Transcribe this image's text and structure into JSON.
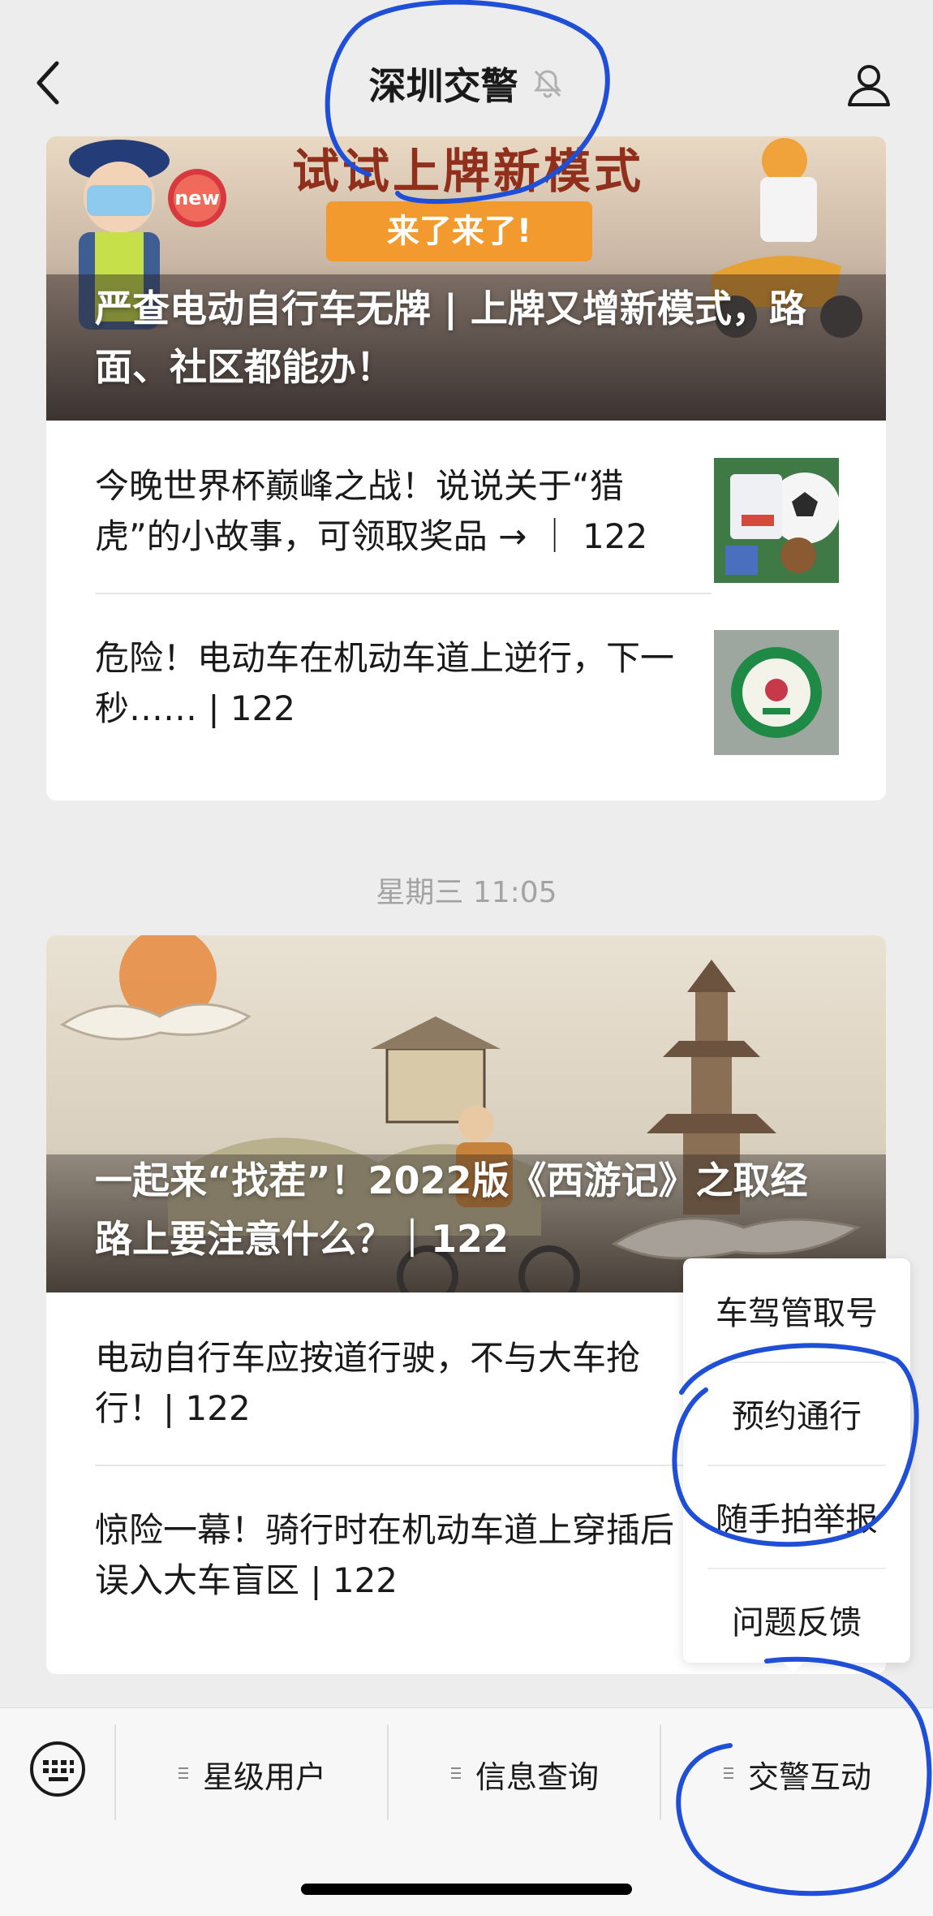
{
  "header": {
    "title": "深圳交警",
    "back_icon": "chevron-left-icon",
    "mute_icon": "bell-muted-icon",
    "profile_icon": "person-icon"
  },
  "feed": {
    "card1": {
      "banner_text": "试试上牌新模式",
      "banner_button": "来了来了!",
      "badge": "new",
      "hero_title": "严查电动自行车无牌 | 上牌又增新模式，路面、社区都能办！",
      "items": [
        {
          "text": "今晚世界杯巅峰之战！说说关于“猎虎”的小故事，可领取奖品 → ｜ 122",
          "thumb_icon": "soccer-prizes-thumb"
        },
        {
          "text": "危险！电动车在机动车道上逆行，下一秒…… | 122",
          "thumb_icon": "badge-thumb"
        }
      ]
    },
    "timestamp": "星期三 11:05",
    "card2": {
      "hero_title": "一起来“找茬”！2022版《西游记》之取经路上要注意什么？｜122",
      "items": [
        {
          "text": "电动自行车应按道行驶，不与大车抢行！| 122"
        },
        {
          "text": "惊险一幕！骑行时在机动车道上穿插后误入大车盲区 | 122"
        }
      ]
    }
  },
  "popup_menu": {
    "items": [
      "车驾管取号",
      "预约通行",
      "随手拍举报",
      "问题反馈"
    ]
  },
  "bottom_bar": {
    "keyboard_icon": "keyboard-icon",
    "tabs": [
      "星级用户",
      "信息查询",
      "交警互动"
    ]
  },
  "colors": {
    "background": "#ededed",
    "card": "#ffffff",
    "annotation": "#1f4fd6",
    "banner_orange": "#f39a2e"
  }
}
